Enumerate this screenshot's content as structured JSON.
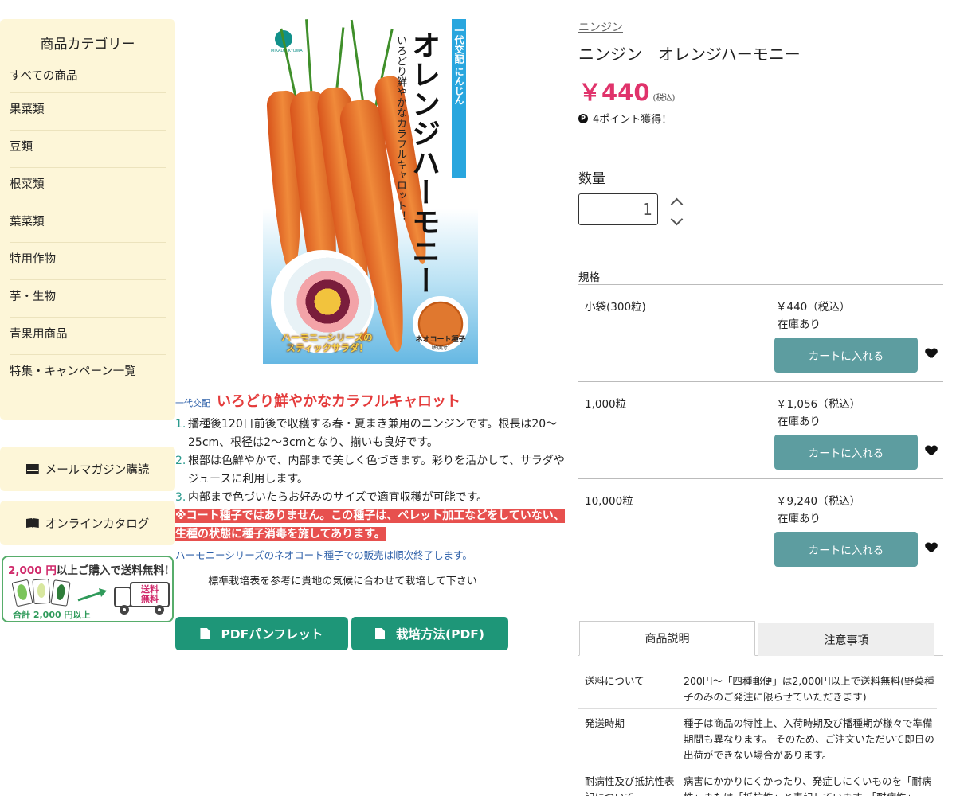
{
  "sidebar": {
    "title": "商品カテゴリー",
    "items": [
      "すべての商品",
      "果菜類",
      "豆類",
      "根菜類",
      "葉菜類",
      "特用作物",
      "芋・生物",
      "青果用商品",
      "特集・キャンペーン一覧"
    ],
    "mail_label": "メールマガジン購読",
    "catalog_label": "オンラインカタログ",
    "banner": {
      "amount": "2,000 円",
      "text": "以上ご購入で送料無料！",
      "sub": "合計 2,000 円以上",
      "truck_label": "送料無料"
    }
  },
  "package": {
    "band_text": "一代交配 にんじん",
    "title": "オレンジハーモニー",
    "subtitle": "いろどり鮮やかなカラフルキャロット！",
    "salad_caption": "ハーモニーシリーズの スティックサラダ！",
    "coat_caption": "ネオコート種子",
    "coat_caption_sub": "（約実寸）",
    "brand": "MIKADO KYOWA"
  },
  "description": {
    "tag": "一代交配",
    "headline": "いろどり鮮やかなカラフルキャロット",
    "points": [
      {
        "num": "1.",
        "text": "播種後120日前後で収穫する春・夏まき兼用のニンジンです。根長は20〜25cm、根径は2〜3cmとなり、揃いも良好です。"
      },
      {
        "num": "2.",
        "text": "根部は色鮮やかで、内部まで美しく色づきます。彩りを活かして、サラダやジュースに利用します。"
      },
      {
        "num": "3.",
        "text": "内部まで色づいたらお好みのサイズで適宜収穫が可能です。"
      }
    ],
    "warning": "※コート種子ではありません。この種子は、ペレット加工などをしていない、生種の状態に種子消毒を施してあります。",
    "notice": "ハーモニーシリーズのネオコート種子での販売は順次終了します。",
    "standard": "標準栽培表を参考に貴地の気候に合わせて栽培して下さい"
  },
  "buttons": {
    "pdf_pamphlet": "PDFパンフレット",
    "cultivation_pdf": "栽培方法(PDF)"
  },
  "product": {
    "breadcrumb": "ニンジン",
    "name": "ニンジン　オレンジハーモニー",
    "price": "￥440",
    "tax_note": "(税込)",
    "points_text": "4ポイント獲得！",
    "points_icon": "P"
  },
  "quantity": {
    "label": "数量",
    "value": "1"
  },
  "spec": {
    "label": "規格",
    "rows": [
      {
        "name": "小袋(300粒)",
        "price": "￥440（税込）",
        "stock": "在庫あり",
        "cart": "カートに入れる"
      },
      {
        "name": "1,000粒",
        "price": "￥1,056（税込）",
        "stock": "在庫あり",
        "cart": "カートに入れる"
      },
      {
        "name": "10,000粒",
        "price": "￥9,240（税込）",
        "stock": "在庫あり",
        "cart": "カートに入れる"
      }
    ]
  },
  "tabs": [
    "商品説明",
    "注意事項"
  ],
  "info": [
    {
      "key": "送料について",
      "value": "200円〜「四種郵便」は2,000円以上で送料無料(野菜種子のみのご発注に限らせていただきます)"
    },
    {
      "key": "発送時期",
      "value": "種子は商品の特性上、入荷時期及び播種期が様々で準備期間も異なります。 そのため、ご注文いただいて即日の出荷ができない場合があります。"
    },
    {
      "key": "耐病性及び抵抗性表記について",
      "value": "病害にかかりにくかったり、発症しにくいものを「耐病性」または「抵抗性」と表記しています。「耐病性」"
    }
  ],
  "colors": {
    "sidebar_bg": "#fdf6d8",
    "price": "#e0336b",
    "pdf_button": "#1e9678",
    "cart_button": "#5d9da0",
    "headline": "#e43b3b",
    "warning_bg": "#e7504e"
  }
}
